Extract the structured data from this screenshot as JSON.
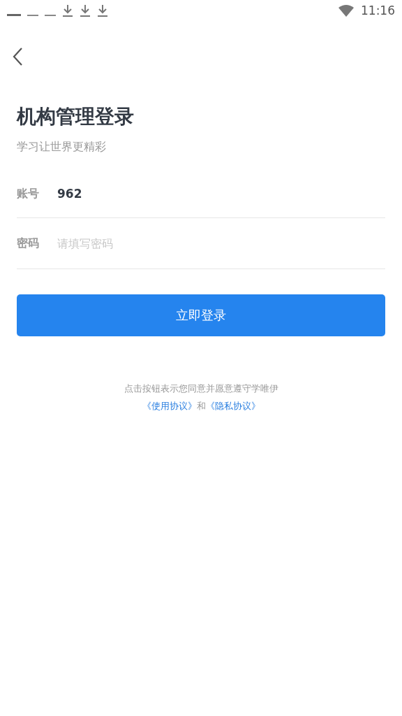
{
  "status_bar": {
    "time": "11:16"
  },
  "title": "机构管理登录",
  "subtitle": "学习让世界更精彩",
  "fields": [
    {
      "label": "账号",
      "value": "962"
    },
    {
      "label": "密码",
      "placeholder": "请填写密码"
    }
  ],
  "login_button": "立即登录",
  "agreement": {
    "text": "点击按钮表示您同意并愿意遵守学唯伊",
    "links": [
      {
        "text": "《使用协议》"
      },
      {
        "text": "《隐私协议》"
      }
    ],
    "joiner": "和"
  }
}
